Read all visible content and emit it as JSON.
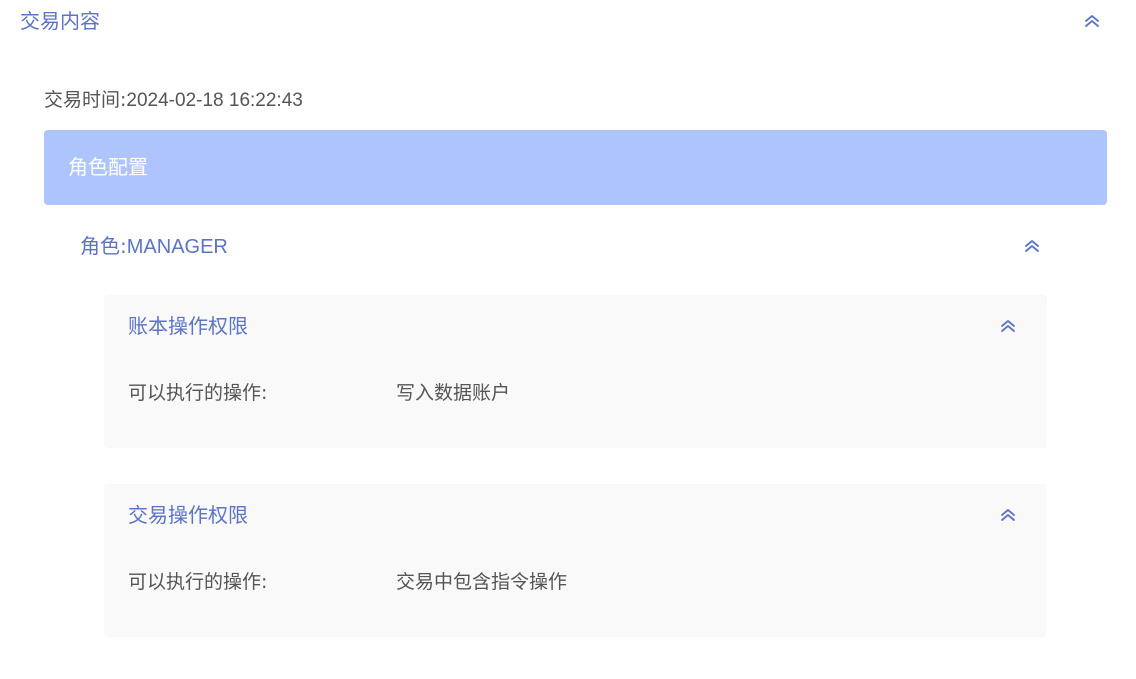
{
  "section": {
    "title": "交易内容"
  },
  "transaction": {
    "time_label": "交易时间:",
    "time_value": "2024-02-18 16:22:43"
  },
  "banner": {
    "label": "角色配置"
  },
  "role": {
    "prefix": "角色:",
    "name": "MANAGER"
  },
  "permissions": [
    {
      "title": "账本操作权限",
      "label": "可以执行的操作:",
      "value": "写入数据账户"
    },
    {
      "title": "交易操作权限",
      "label": "可以执行的操作:",
      "value": "交易中包含指令操作"
    }
  ],
  "icons": {
    "collapse": "chevron-double-up-icon"
  },
  "colors": {
    "accent": "#5b74c4",
    "banner_bg": "#adc5fc",
    "card_bg": "#f9f9f9",
    "text": "#555555"
  }
}
